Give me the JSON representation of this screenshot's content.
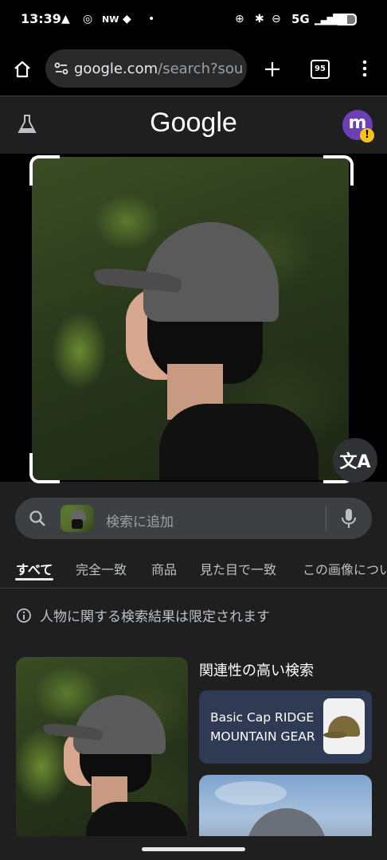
{
  "status_bar": {
    "time": "13:39",
    "network": "5G",
    "left_icons": [
      "warning-icon",
      "chrome-icon",
      "news-icon",
      "discord-icon",
      "dot-icon"
    ],
    "right_icons": [
      "data-saver-icon",
      "bluetooth-icon",
      "dnd-icon",
      "signal-icon",
      "battery-icon"
    ]
  },
  "browser": {
    "url_host": "google.com",
    "url_path": "/search?sou",
    "tab_count": "95",
    "icons": [
      "home-icon",
      "site-settings-icon",
      "new-tab-icon",
      "tabs-icon",
      "more-icon"
    ]
  },
  "google_header": {
    "logo": "Google",
    "avatar_letter": "m",
    "icons": [
      "labs-flask-icon",
      "warning-badge-icon"
    ]
  },
  "search": {
    "placeholder": "検索に追加",
    "icons": [
      "search-icon",
      "mic-icon"
    ]
  },
  "tabs": [
    {
      "label": "すべて",
      "active": true
    },
    {
      "label": "完全一致",
      "active": false
    },
    {
      "label": "商品",
      "active": false
    },
    {
      "label": "見た目で一致",
      "active": false
    },
    {
      "label": "この画像につい",
      "active": false
    }
  ],
  "notice": "人物に関する検索結果は限定されます",
  "related": {
    "title": "関連性の高い検索",
    "card1_line1": "Basic Cap RIDGE",
    "card1_line2": "MOUNTAIN GEAR"
  },
  "colors": {
    "background": "#1f1f1f",
    "avatar": "#6d3fb5",
    "card": "#2f3a55",
    "searchbar": "#3c4043"
  }
}
